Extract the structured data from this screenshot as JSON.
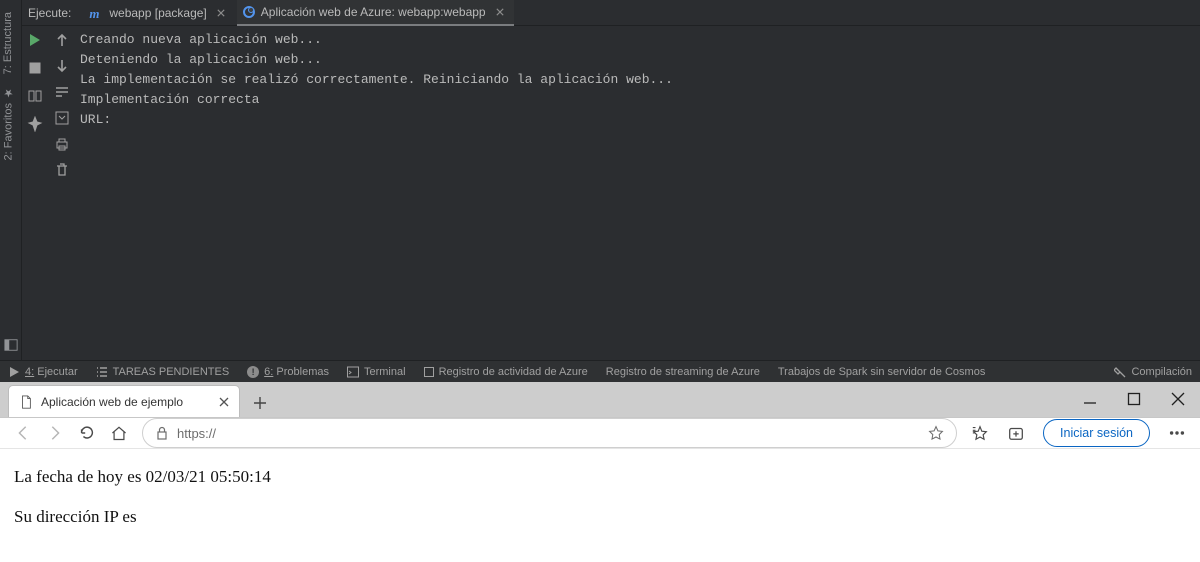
{
  "ide": {
    "run_label": "Ejecute:",
    "tabs": [
      {
        "label": "webapp [package]"
      },
      {
        "label": "Aplicación web de Azure: webapp:webapp"
      }
    ],
    "sidebar": {
      "estructura": "7: Estructura",
      "favoritos": "2: Favoritos"
    },
    "console": [
      "Creando nueva aplicación web...",
      "Deteniendo la aplicación web...",
      "La implementación se realizó correctamente. Reiniciando la aplicación web...",
      "Implementación correcta",
      "URL:"
    ],
    "bottom": {
      "ejecutar_num": "4:",
      "ejecutar": "Ejecutar",
      "tareas": "TAREAS PENDIENTES",
      "problemas_num": "6:",
      "problemas": "Problemas",
      "terminal": "Terminal",
      "registro_act": "Registro de actividad de Azure",
      "registro_stream": "Registro de streaming de Azure",
      "spark": "Trabajos de Spark sin servidor de Cosmos",
      "compilacion": "Compilación"
    }
  },
  "browser": {
    "tab_title": "Aplicación web de ejemplo",
    "url": "https://",
    "login": "Iniciar sesión",
    "page_line1": "La fecha de hoy es 02/03/21 05:50:14",
    "page_line2": "Su dirección IP es"
  }
}
